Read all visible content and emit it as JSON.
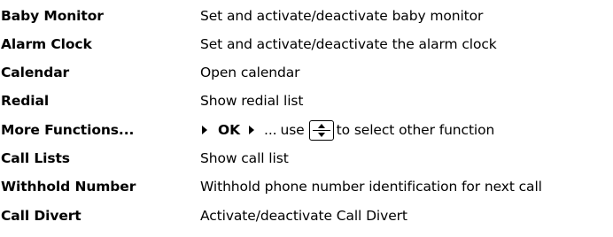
{
  "rows": [
    {
      "label": "Baby Monitor",
      "description": "Set and activate/deactivate baby monitor"
    },
    {
      "label": "Alarm Clock",
      "description": "Set and activate/deactivate the alarm clock"
    },
    {
      "label": "Calendar",
      "description": "Open calendar"
    },
    {
      "label": "Redial",
      "description": "Show redial list"
    },
    {
      "label": "More Functions...",
      "description": {
        "ok": "OK",
        "dots": "...",
        "use": "use",
        "key_icon": "navigation-key-up-down-icon",
        "after": "to select other function"
      }
    },
    {
      "label": "Call Lists",
      "description": "Show call list"
    },
    {
      "label": "Withhold Number",
      "description": "Withhold phone number identification for next call"
    },
    {
      "label": "Call Divert",
      "description": "Activate/deactivate Call Divert"
    }
  ]
}
